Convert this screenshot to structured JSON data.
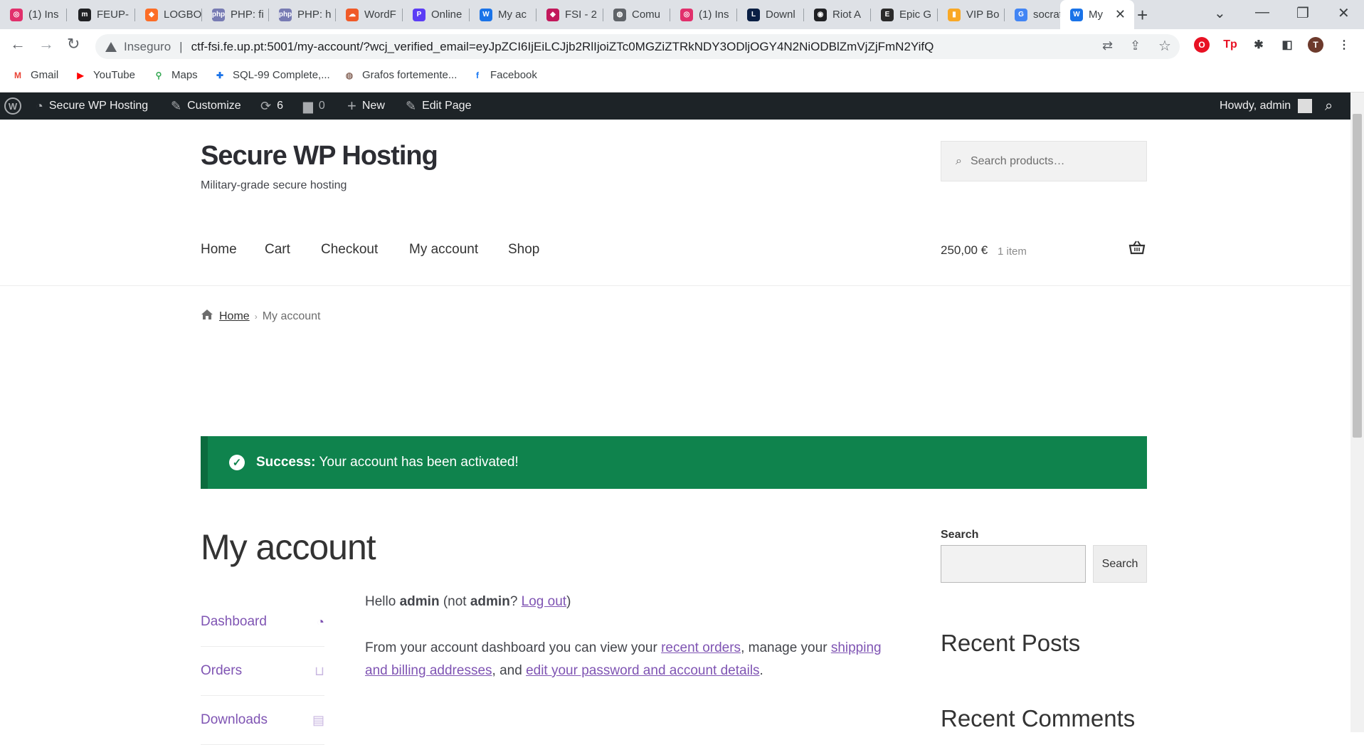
{
  "browser": {
    "tabs": [
      {
        "label": "(1) Ins",
        "color": "#e1306c",
        "glyph": "◎"
      },
      {
        "label": "FEUP-",
        "color": "#202124",
        "glyph": "m"
      },
      {
        "label": "LOGBO",
        "color": "#fc6d26",
        "glyph": "◆"
      },
      {
        "label": "PHP: fi",
        "color": "#777bb3",
        "glyph": "php"
      },
      {
        "label": "PHP: h",
        "color": "#777bb3",
        "glyph": "php"
      },
      {
        "label": "WordF",
        "color": "#f05a28",
        "glyph": "☁"
      },
      {
        "label": "Online",
        "color": "#5b3df5",
        "glyph": "P"
      },
      {
        "label": "My ac",
        "color": "#1a73e8",
        "glyph": "W"
      },
      {
        "label": "FSI - 2",
        "color": "#c2185b",
        "glyph": "◆"
      },
      {
        "label": "Comu",
        "color": "#5f6368",
        "glyph": "◍"
      },
      {
        "label": "(1) Ins",
        "color": "#e1306c",
        "glyph": "◎"
      },
      {
        "label": "Downl",
        "color": "#0a1f44",
        "glyph": "L"
      },
      {
        "label": "Riot A",
        "color": "#202124",
        "glyph": "◉"
      },
      {
        "label": "Epic G",
        "color": "#2a2a2a",
        "glyph": "E"
      },
      {
        "label": "VIP Bo",
        "color": "#f9a825",
        "glyph": "▮"
      },
      {
        "label": "socrat",
        "color": "#4285f4",
        "glyph": "G"
      },
      {
        "label": "My",
        "color": "#1a73e8",
        "glyph": "W",
        "active": true
      }
    ],
    "new_tab": "+",
    "window_controls": {
      "dropdown": "⌄",
      "minimize": "—",
      "maximize": "❐",
      "close": "✕"
    },
    "nav": {
      "back": "←",
      "forward": "→",
      "reload": "↻"
    },
    "security_label": "Inseguro",
    "separator": "|",
    "url": "ctf-fsi.fe.up.pt:5001/my-account/?wcj_verified_email=eyJpZCI6IjEiLCJjb2RlIjoiZTc0MGZiZTRkNDY3ODljOGY4N2NiODBlZmVjZjFmN2YifQ",
    "omnibox_icons": {
      "translate": "⇄",
      "share": "⇪",
      "bookmark": "☆"
    },
    "extensions": [
      {
        "name": "opera-ext-icon",
        "glyph": "O",
        "color": "#e81123"
      },
      {
        "name": "tp-ext-icon",
        "glyph": "Tp",
        "color": "#ffffff",
        "text_color": "#e81123"
      },
      {
        "name": "puzzle-icon",
        "glyph": "✱",
        "color": "#ffffff",
        "text_color": "#3c4043"
      },
      {
        "name": "sidepanel-icon",
        "glyph": "◧",
        "color": "#ffffff",
        "text_color": "#3c4043"
      },
      {
        "name": "profile-avatar",
        "glyph": "T",
        "color": "#6d3a2c"
      },
      {
        "name": "menu-icon",
        "glyph": "⋮",
        "color": "#ffffff",
        "text_color": "#3c4043"
      }
    ],
    "bookmarks": [
      {
        "label": "Gmail",
        "glyph": "M",
        "color": "#ea4335"
      },
      {
        "label": "YouTube",
        "glyph": "▶",
        "color": "#ff0000"
      },
      {
        "label": "Maps",
        "glyph": "⚲",
        "color": "#34a853"
      },
      {
        "label": "SQL-99 Complete,...",
        "glyph": "✚",
        "color": "#1a73e8"
      },
      {
        "label": "Grafos fortemente...",
        "glyph": "◍",
        "color": "#8d6e63"
      },
      {
        "label": "Facebook",
        "glyph": "f",
        "color": "#1877f2"
      }
    ]
  },
  "adminbar": {
    "wp_logo": "W",
    "site_name": "Secure WP Hosting",
    "customize": "Customize",
    "updates_count": "6",
    "comments_count": "0",
    "new": "New",
    "edit_page": "Edit Page",
    "howdy": "Howdy, admin"
  },
  "header": {
    "site_title": "Secure WP Hosting",
    "tagline": "Military-grade secure hosting",
    "search_placeholder": "Search products…",
    "nav": [
      "Home",
      "Cart",
      "Checkout",
      "My account",
      "Shop"
    ],
    "cart_total": "250,00 €",
    "cart_count": "1 item"
  },
  "breadcrumb": {
    "home": "Home",
    "current": "My account"
  },
  "notice": {
    "strong": "Success:",
    "message": "Your account has been activated!"
  },
  "page": {
    "title": "My account",
    "account_nav": [
      {
        "label": "Dashboard",
        "icon": "dashboard-icon",
        "glyph": "◔"
      },
      {
        "label": "Orders",
        "icon": "basket-icon",
        "glyph": "⊔"
      },
      {
        "label": "Downloads",
        "icon": "file-icon",
        "glyph": "▤"
      }
    ],
    "hello": {
      "prefix": "Hello",
      "user": "admin",
      "not_text": "(not",
      "user2": "admin",
      "question": "?",
      "logout": "Log out",
      "close": ")"
    },
    "intro": {
      "t1": "From your account dashboard you can view your",
      "l1": "recent orders",
      "t2": ", manage your",
      "l2": "shipping and billing addresses",
      "t3": ", and",
      "l3": "edit your password and account details",
      "t4": "."
    }
  },
  "sidebar": {
    "search_label": "Search",
    "search_button": "Search",
    "recent_posts": "Recent Posts",
    "recent_comments": "Recent Comments"
  },
  "colors": {
    "accent": "#7f54b3",
    "success": "#0f834d",
    "adminbar": "#1d2327"
  }
}
